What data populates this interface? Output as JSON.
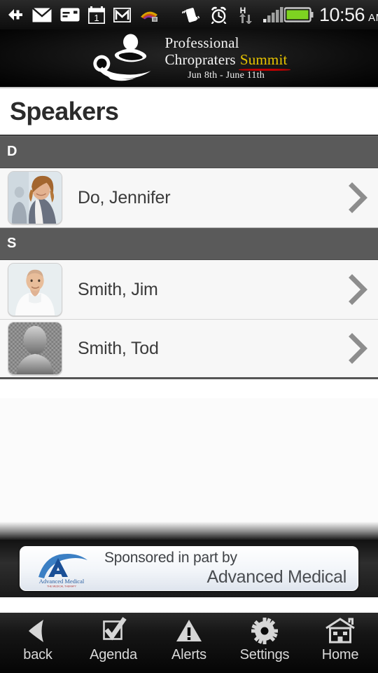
{
  "statusbar": {
    "time": "10:56",
    "ampm": "AM",
    "left_icons": [
      "download-arrow-icon",
      "envelope-icon",
      "sms-card-icon",
      "calendar-icon",
      "gmail-icon",
      "media-rainbow-icon"
    ],
    "right_icons": [
      "vibrate-icon",
      "alarm-clock-icon",
      "hspa-data-icon",
      "signal-bars-icon",
      "battery-icon"
    ],
    "calendar_day": "1",
    "data_network": "H",
    "battery_color": "#7ed321"
  },
  "banner": {
    "title_line1": "Professional",
    "title_line2_a": "Chropraters",
    "title_line2_b": "Summit",
    "dates": "Jun 8th - June 11th",
    "logo_icon": "chiropractic-logo-icon",
    "summit_color": "#e8c400",
    "underline_color": "#c00000"
  },
  "page": {
    "title": "Speakers"
  },
  "sections": [
    {
      "letter": "D",
      "rows": [
        {
          "name": "Do, Jennifer",
          "avatar": "photo-woman-blazer",
          "chevron": "chevron-right-icon"
        }
      ]
    },
    {
      "letter": "S",
      "rows": [
        {
          "name": "Smith, Jim",
          "avatar": "photo-man-white-tshirt",
          "chevron": "chevron-right-icon"
        },
        {
          "name": "Smith, Tod",
          "avatar": "placeholder-silhouette",
          "chevron": "chevron-right-icon"
        }
      ]
    }
  ],
  "sponsor": {
    "line1": "Sponsored in part by",
    "line2": "Advanced Medical",
    "logo_icon": "advanced-medical-logo-icon",
    "logo_caption": "Advanced Medical",
    "logo_color": "#1f5fa8"
  },
  "navbar": {
    "items": [
      {
        "label": "back",
        "icon": "back-arrow-icon"
      },
      {
        "label": "Agenda",
        "icon": "checkbox-check-icon"
      },
      {
        "label": "Alerts",
        "icon": "warning-triangle-icon"
      },
      {
        "label": "Settings",
        "icon": "gear-icon"
      },
      {
        "label": "Home",
        "icon": "house-icon"
      }
    ]
  }
}
